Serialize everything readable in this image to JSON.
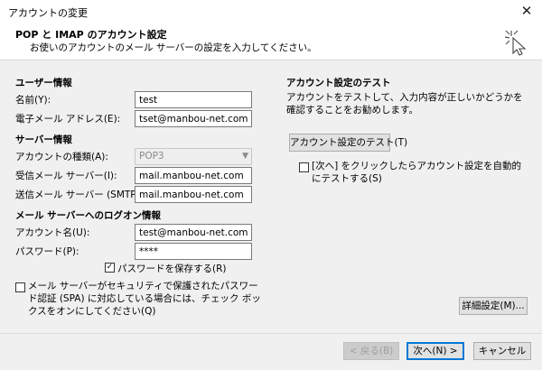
{
  "window": {
    "title": "アカウントの変更",
    "close_glyph": "✕"
  },
  "header": {
    "title": "POP と IMAP のアカウント設定",
    "subtitle": "お使いのアカウントのメール サーバーの設定を入力してください。",
    "icon": "cursor-sparkle-icon"
  },
  "user_info": {
    "section_title": "ユーザー情報",
    "name_label": "名前(Y):",
    "name_value": "test",
    "email_label": "電子メール アドレス(E):",
    "email_value": "tset@manbou-net.com"
  },
  "server_info": {
    "section_title": "サーバー情報",
    "account_type_label": "アカウントの種類(A):",
    "account_type_value": "POP3",
    "incoming_label": "受信メール サーバー(I):",
    "incoming_value": "mail.manbou-net.com",
    "outgoing_label": "送信メール サーバー (SMTP)(O):",
    "outgoing_value": "mail.manbou-net.com"
  },
  "logon_info": {
    "section_title": "メール サーバーへのログオン情報",
    "account_name_label": "アカウント名(U):",
    "account_name_value": "test@manbou-net.com",
    "password_label": "パスワード(P):",
    "password_value": "****",
    "save_password_label": "パスワードを保存する(R)",
    "save_password_checked": true,
    "spa_label": "メール サーバーがセキュリティで保護されたパスワード認証 (SPA) に対応している場合には、チェック ボックスをオンにしてください(Q)",
    "spa_checked": false
  },
  "test_settings": {
    "section_title": "アカウント設定のテスト",
    "description": "アカウントをテストして、入力内容が正しいかどうかを確認することをお勧めします。",
    "test_button": "アカウント設定のテスト(T)",
    "auto_test_label": "[次へ] をクリックしたらアカウント設定を自動的にテストする(S)",
    "auto_test_checked": false
  },
  "buttons": {
    "more_settings": "詳細設定(M)...",
    "back": "< 戻る(B)",
    "next": "次へ(N) >",
    "cancel": "キャンセル"
  },
  "colors": {
    "primary_border": "#0078d7"
  }
}
